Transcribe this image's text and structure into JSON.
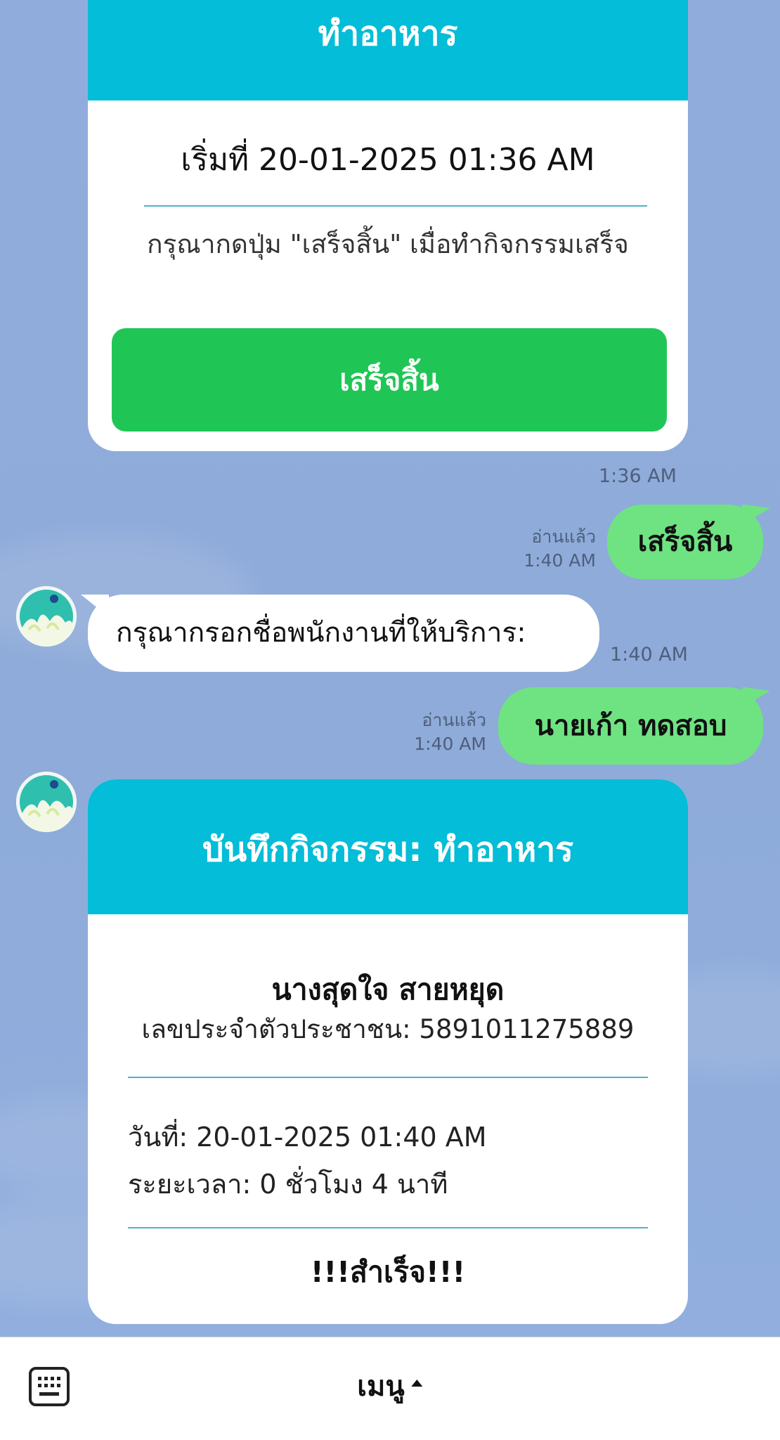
{
  "activity_card": {
    "header": "ทำอาหาร",
    "start_time": "เริ่มที่ 20-01-2025 01:36 AM",
    "instruction": "กรุณากดปุ่ม \"เสร็จสิ้น\" เมื่อทำกิจกรรมเสร็จ",
    "done_button": "เสร็จสิ้น",
    "sent_time": "1:36 AM",
    "accent_color": "#04bdd8",
    "button_color": "#1fc655"
  },
  "messages": [
    {
      "side": "right",
      "text": "เสร็จสิ้น",
      "read_label": "อ่านแล้ว",
      "time": "1:40 AM"
    },
    {
      "side": "left",
      "text": "กรุณากรอกชื่อพนักงานที่ให้บริการ:",
      "time": "1:40 AM"
    },
    {
      "side": "right",
      "text": "นายเก้า ทดสอบ",
      "read_label": "อ่านแล้ว",
      "time": "1:40 AM"
    }
  ],
  "record_card": {
    "header": "บันทึกกิจกรรม: ทำอาหาร",
    "name": "นางสุดใจ สายหยุด",
    "id_line": "เลขประจำตัวประชาชน: 5891011275889",
    "date_line": "วันที่: 20-01-2025 01:40 AM",
    "duration_line": "ระยะเวลา: 0 ชั่วโมง 4 นาที",
    "status": "!!!สำเร็จ!!!"
  },
  "bottom_bar": {
    "keyboard_icon": "keyboard-icon",
    "menu_label": "เมนู"
  }
}
